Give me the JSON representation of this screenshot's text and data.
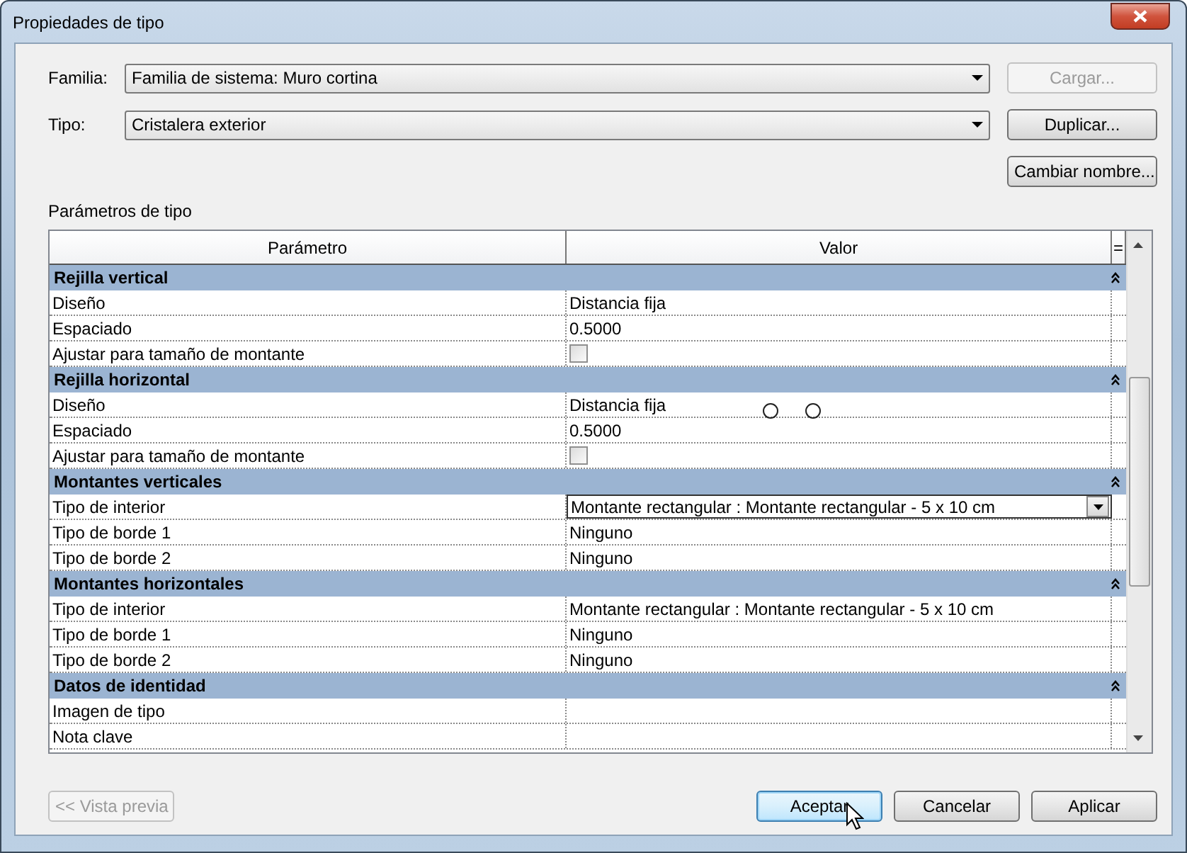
{
  "window": {
    "title": "Propiedades de tipo"
  },
  "fields": [
    {
      "label": "Familia:",
      "value": "Familia de sistema: Muro cortina"
    },
    {
      "label": "Tipo:",
      "value": "Cristalera exterior"
    }
  ],
  "side_buttons": [
    {
      "label": "Cargar...",
      "disabled": true
    },
    {
      "label": "Duplicar...",
      "disabled": false
    },
    {
      "label": "Cambiar nombre...",
      "disabled": false
    }
  ],
  "section_label": "Parámetros de tipo",
  "table": {
    "columns": [
      "Parámetro",
      "Valor",
      "="
    ],
    "groups": [
      {
        "title": "Rejilla vertical",
        "expanded": true,
        "rows": [
          {
            "name": "Diseño",
            "kind": "text",
            "value": "Distancia fija",
            "active": false
          },
          {
            "name": "Espaciado",
            "kind": "text",
            "value": "0.5000",
            "active": false
          },
          {
            "name": "Ajustar para tamaño de montante",
            "kind": "checkbox",
            "checked": false,
            "active": false
          }
        ]
      },
      {
        "title": "Rejilla horizontal",
        "expanded": true,
        "rows": [
          {
            "name": "Diseño",
            "kind": "text",
            "value": "Distancia fija",
            "active": false
          },
          {
            "name": "Espaciado",
            "kind": "text",
            "value": "0.5000",
            "active": false
          },
          {
            "name": "Ajustar para tamaño de montante",
            "kind": "checkbox",
            "checked": false,
            "active": false
          }
        ]
      },
      {
        "title": "Montantes verticales",
        "expanded": true,
        "rows": [
          {
            "name": "Tipo de interior",
            "kind": "text",
            "value": "Montante rectangular : Montante rectangular - 5 x 10 cm",
            "active": true
          },
          {
            "name": "Tipo de borde 1",
            "kind": "text",
            "value": "Ninguno",
            "active": false
          },
          {
            "name": "Tipo de borde 2",
            "kind": "text",
            "value": "Ninguno",
            "active": false
          }
        ]
      },
      {
        "title": "Montantes horizontales",
        "expanded": true,
        "rows": [
          {
            "name": "Tipo de interior",
            "kind": "text",
            "value": "Montante rectangular : Montante rectangular - 5 x 10 cm",
            "active": false
          },
          {
            "name": "Tipo de borde 1",
            "kind": "text",
            "value": "Ninguno",
            "active": false
          },
          {
            "name": "Tipo de borde 2",
            "kind": "text",
            "value": "Ninguno",
            "active": false
          }
        ]
      },
      {
        "title": "Datos de identidad",
        "expanded": true,
        "rows": [
          {
            "name": "Imagen de tipo",
            "kind": "text",
            "active": false
          },
          {
            "name": "Nota clave",
            "kind": "text",
            "active": false
          }
        ]
      }
    ]
  },
  "buttons": [
    {
      "label": "<< Vista previa",
      "disabled": true,
      "default": false
    },
    {
      "label": "Aceptar",
      "disabled": false,
      "default": true
    },
    {
      "label": "Cancelar",
      "disabled": false,
      "default": false
    },
    {
      "label": "Aplicar",
      "disabled": false,
      "default": false
    }
  ]
}
